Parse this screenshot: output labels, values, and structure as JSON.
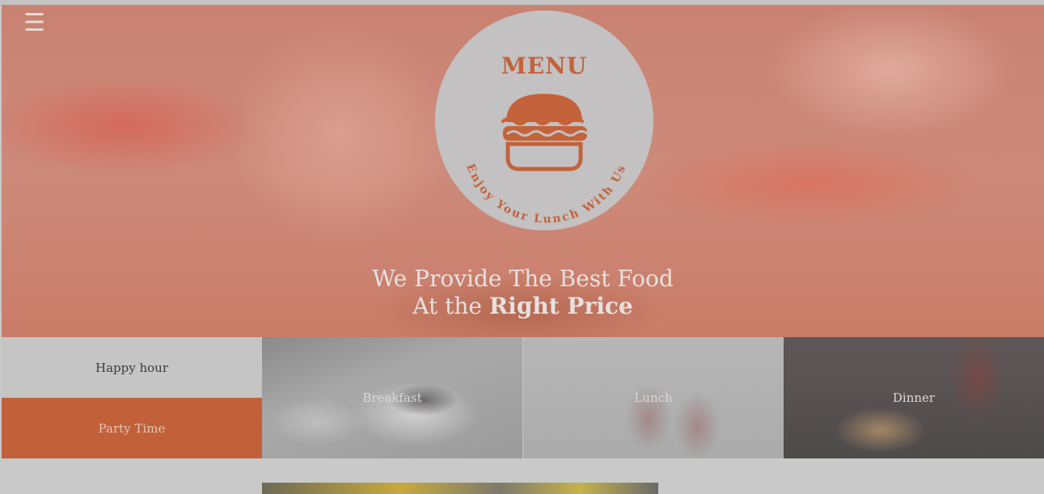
{
  "header": {
    "menu_toggle_glyph": "☰",
    "badge_title": "MENU",
    "badge_subtitle": "Enjoy Your Lunch With Us",
    "badge_icon": "burger-icon"
  },
  "hero": {
    "line1": "We Provide The Best Food",
    "line2_prefix": "At the",
    "line2_emphasis": "Right Price"
  },
  "tiles": {
    "happy_hour": "Happy hour",
    "party_time": "Party Time",
    "breakfast": "Breakfast",
    "lunch": "Lunch",
    "dinner": "Dinner"
  },
  "colors": {
    "accent": "#c2603a",
    "badge_bg": "#c3c1c1"
  }
}
